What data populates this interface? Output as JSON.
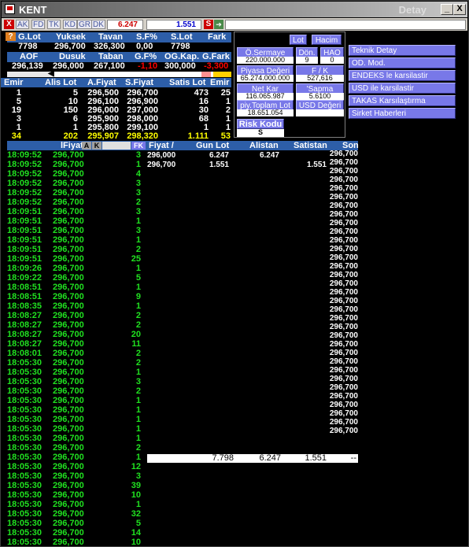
{
  "window": {
    "title": "KENT",
    "title_right": "Detay",
    "min_label": "_",
    "max_label": "□",
    "close_label": "X"
  },
  "toolbar": {
    "close_label": "X",
    "tabs": [
      "AK",
      "FD",
      "TK",
      "KD",
      "GR",
      "DK"
    ],
    "box1": "6.247",
    "box2": "1.551",
    "s_label": "S"
  },
  "summary": {
    "row1_headers": [
      "G.Lot",
      "Yuksek",
      "Tavan",
      "S.F%",
      "S.Lot",
      "Fark"
    ],
    "row1_values": [
      "7798",
      "296,700",
      "326,300",
      "0,00",
      "7798",
      ""
    ],
    "row2_headers": [
      "AOF",
      "Dusuk",
      "Taban",
      "G.F%",
      "OG.Kap.",
      "G.Fark"
    ],
    "row2_values": [
      "296,139",
      "296,000",
      "267,100",
      "-1,10",
      "300,000",
      "-3,300"
    ]
  },
  "depth": {
    "headers": [
      "Emir",
      "Alis Lot",
      "A.Fiyat",
      "S.Fiyat",
      "Satis Lot",
      "Emir"
    ],
    "rows": [
      [
        "1",
        "5",
        "296,500",
        "296,700",
        "473",
        "25"
      ],
      [
        "5",
        "10",
        "296,100",
        "296,900",
        "16",
        "1"
      ],
      [
        "19",
        "150",
        "296,000",
        "297,000",
        "30",
        "2"
      ],
      [
        "3",
        "6",
        "295,900",
        "298,000",
        "68",
        "1"
      ],
      [
        "1",
        "1",
        "295,800",
        "299,100",
        "1",
        "1"
      ]
    ],
    "totals": [
      "34",
      "202",
      "295,907",
      "298,320",
      "1.111",
      "53"
    ]
  },
  "panel": {
    "lot_label": "Lot",
    "hacim_label": "Hacim",
    "osermaye_label": "Ö.Sermaye",
    "osermaye_value": "220.000.000",
    "don_label": "Dön.",
    "don_value": "9",
    "hao_label": "HAO",
    "hao_value": "0",
    "piyasa_label": "Piyasa Değeri",
    "piyasa_value": "65.274.000.000",
    "fk_label": "F / K",
    "fk_value": "527,616",
    "netkar_label": "Net Kar",
    "netkar_value": "116.065.987",
    "sapma_label": "'Sapma",
    "sapma_value": "5.6100",
    "piy_toplam_label": "piy.Toplam Lot",
    "piy_toplam_value": "18.651.054",
    "usd_label": "USD Değeri",
    "risk_label": "Risk Kodu",
    "risk_value": "S"
  },
  "links": [
    "Teknik Detay",
    "OD. Mod.",
    "ENDEKS le karsilastir",
    "USD ile karsilastir",
    "TAKAS Karsılaştırma",
    "Sirket Haberleri"
  ],
  "trades_header": {
    "fiyat": "lFiyat",
    "a": "A",
    "k": "K",
    "fk": "FK",
    "fiyat2": "Fiyat /",
    "gun_lot": "Gun Lot",
    "alistan": "Alistan",
    "satistan": "Satistan",
    "son": "Son"
  },
  "price_summary": [
    {
      "fiyat": "296,000",
      "gun_lot": "6.247",
      "alistan": "6.247",
      "satistan": ""
    },
    {
      "fiyat": "296,700",
      "gun_lot": "1.551",
      "alistan": "",
      "satistan": "1.551"
    }
  ],
  "totals_row": {
    "gun_lot": "7.798",
    "alistan": "6.247",
    "satistan": "1.551",
    "son": "--"
  },
  "trades": [
    [
      "18:09:52",
      "296,700",
      "3"
    ],
    [
      "18:09:52",
      "296,700",
      "1"
    ],
    [
      "18:09:52",
      "296,700",
      "4"
    ],
    [
      "18:09:52",
      "296,700",
      "3"
    ],
    [
      "18:09:52",
      "296,700",
      "3"
    ],
    [
      "18:09:52",
      "296,700",
      "2"
    ],
    [
      "18:09:51",
      "296,700",
      "3"
    ],
    [
      "18:09:51",
      "296,700",
      "1"
    ],
    [
      "18:09:51",
      "296,700",
      "3"
    ],
    [
      "18:09:51",
      "296,700",
      "1"
    ],
    [
      "18:09:51",
      "296,700",
      "2"
    ],
    [
      "18:09:51",
      "296,700",
      "25"
    ],
    [
      "18:09:26",
      "296,700",
      "1"
    ],
    [
      "18:09:22",
      "296,700",
      "5"
    ],
    [
      "18:08:51",
      "296,700",
      "1"
    ],
    [
      "18:08:51",
      "296,700",
      "9"
    ],
    [
      "18:08:35",
      "296,700",
      "1"
    ],
    [
      "18:08:27",
      "296,700",
      "2"
    ],
    [
      "18:08:27",
      "296,700",
      "2"
    ],
    [
      "18:08:27",
      "296,700",
      "20"
    ],
    [
      "18:08:27",
      "296,700",
      "11"
    ],
    [
      "18:08:01",
      "296,700",
      "2"
    ],
    [
      "18:05:30",
      "296,700",
      "2"
    ],
    [
      "18:05:30",
      "296,700",
      "1"
    ],
    [
      "18:05:30",
      "296,700",
      "3"
    ],
    [
      "18:05:30",
      "296,700",
      "2"
    ],
    [
      "18:05:30",
      "296,700",
      "1"
    ],
    [
      "18:05:30",
      "296,700",
      "1"
    ],
    [
      "18:05:30",
      "296,700",
      "1"
    ],
    [
      "18:05:30",
      "296,700",
      "1"
    ],
    [
      "18:05:30",
      "296,700",
      "1"
    ],
    [
      "18:05:30",
      "296,700",
      "2"
    ],
    [
      "18:05:30",
      "296,700",
      "1"
    ],
    [
      "18:05:30",
      "296,700",
      "12"
    ],
    [
      "18:05:30",
      "296,700",
      "3"
    ],
    [
      "18:05:30",
      "296,700",
      "39"
    ],
    [
      "18:05:30",
      "296,700",
      "10"
    ],
    [
      "18:05:30",
      "296,700",
      "1"
    ],
    [
      "18:05:30",
      "296,700",
      "32"
    ],
    [
      "18:05:30",
      "296,700",
      "5"
    ],
    [
      "18:05:30",
      "296,700",
      "14"
    ],
    [
      "18:05:30",
      "296,700",
      "10"
    ]
  ],
  "son_values": [
    "296,700",
    "296,700",
    "296,700",
    "296,700",
    "296,700",
    "296,700",
    "296,700",
    "296,700",
    "296,700",
    "296,700",
    "296,700",
    "296,700",
    "296,700",
    "296,700",
    "296,700",
    "296,700",
    "296,700",
    "296,700",
    "296,700",
    "296,700",
    "296,700",
    "296,700",
    "296,700",
    "296,700",
    "296,700",
    "296,700",
    "296,700",
    "296,700",
    "296,700",
    "296,700",
    "296,700",
    "296,700",
    "296,700"
  ]
}
